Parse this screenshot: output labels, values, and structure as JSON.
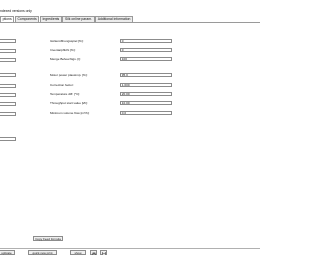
{
  "options": {
    "label": "ndexed versions only"
  },
  "tabs": [
    {
      "label": "ptions",
      "active": true
    },
    {
      "label": "Components"
    },
    {
      "label": "Ingredients"
    },
    {
      "label": "Silk online param."
    },
    {
      "label": "Additional information"
    }
  ],
  "form": {
    "rows": [
      {
        "label": "Gültenöffnungsspiel [%]:",
        "value": "0"
      },
      {
        "label": "Inventarpflicht [%]:",
        "value": "0"
      },
      {
        "label": "Menge Befeuchtgs. [l]:",
        "value": "100"
      },
      {
        "label": "Motor power plausimp. [%]:",
        "value": "95,0"
      },
      {
        "label": "Correction factor:",
        "value": "1,000"
      },
      {
        "label": "Temperature diff. [°C]:",
        "value": "20,00"
      },
      {
        "label": "Throughput start value [t/h]:",
        "value": "10,00"
      },
      {
        "label": "Minimum volume flow [m³/h]:",
        "value": "0,0"
      }
    ]
  },
  "buttons": {
    "copy_feed": "Copy Feed formula",
    "duplicate": "uplicate",
    "quick_new_print": "quick new print",
    "show": "show"
  },
  "icons": {
    "print": "print-icon",
    "save": "save-icon"
  }
}
